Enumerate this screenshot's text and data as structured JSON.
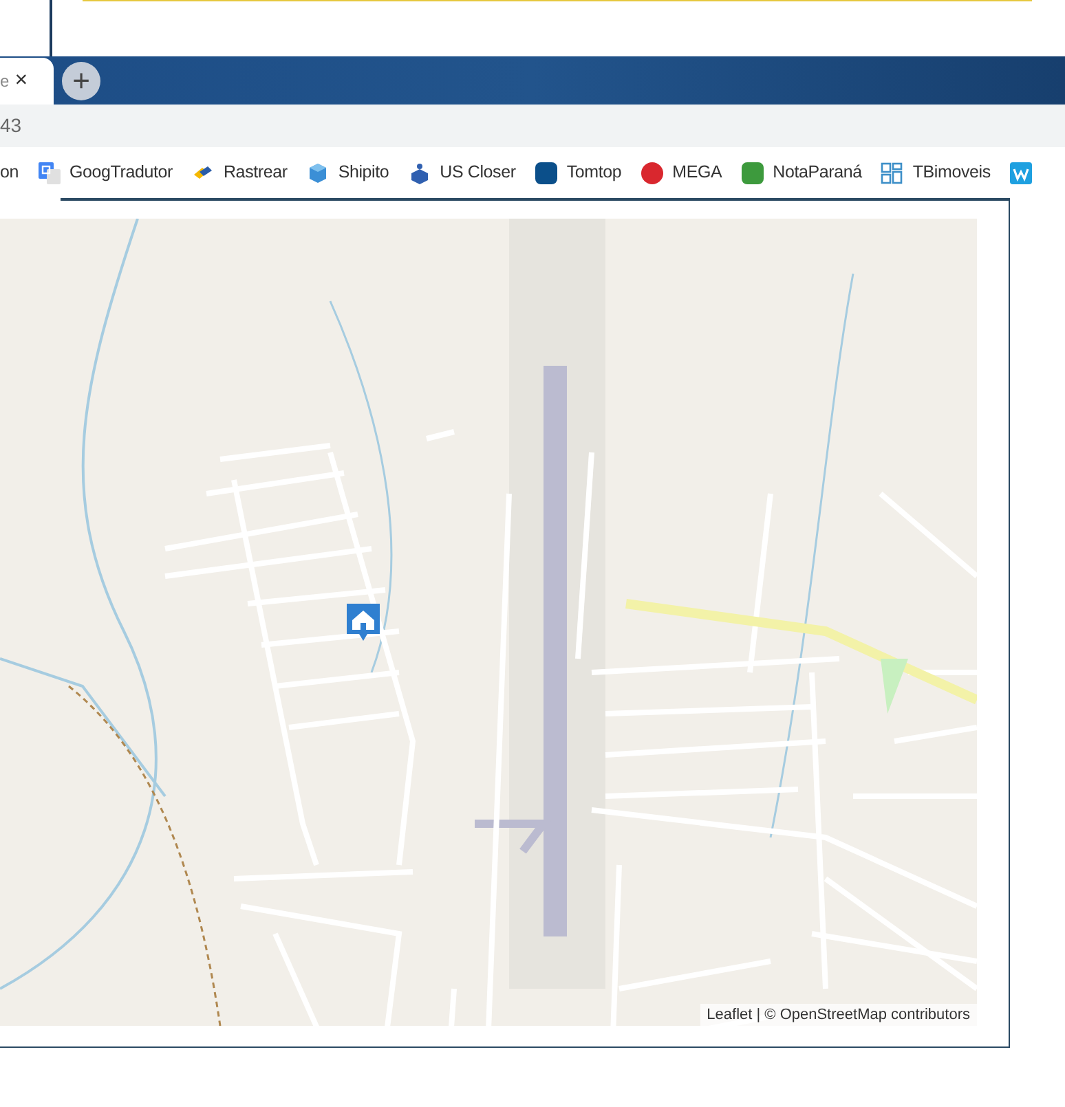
{
  "browser_tab": {
    "title": "e",
    "close": "×"
  },
  "new_tab": {
    "label": "+"
  },
  "address_bar": {
    "value": "43"
  },
  "bookmarks": [
    {
      "label": "on",
      "kind": "none"
    },
    {
      "label": "GoogTradutor",
      "kind": "translate"
    },
    {
      "label": "Rastrear",
      "kind": "track"
    },
    {
      "label": "Shipito",
      "kind": "cube"
    },
    {
      "label": "US Closer",
      "kind": "box"
    },
    {
      "label": "Tomtop",
      "kind": "tt"
    },
    {
      "label": "MEGA",
      "kind": "mega"
    },
    {
      "label": "NotaParaná",
      "kind": "nota"
    },
    {
      "label": "TBimoveis",
      "kind": "grid"
    },
    {
      "kind": "w"
    }
  ],
  "map": {
    "attribution": "Leaflet | © OpenStreetMap contributors"
  }
}
